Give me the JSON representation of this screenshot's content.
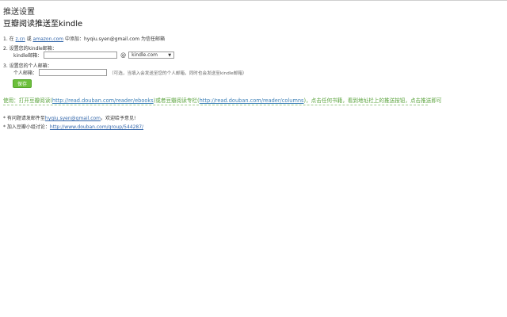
{
  "header": {
    "title": "推送设置",
    "subtitle": "豆瓣阅读推送至kindle"
  },
  "step1": {
    "prefix": "1. 在 ",
    "link1": "z.cn",
    "middle1": " 或 ",
    "link2": "amazon.com",
    "middle2": " 中添加：hyqiu.syen@gmail.com 为信任邮箱"
  },
  "step2": {
    "title": "2. 设置您的kindle邮箱：",
    "label": "kindle邮箱：",
    "input_value": "",
    "at": "@",
    "domain_selected": "kindle.com"
  },
  "step3": {
    "title": "3. 设置您的个人邮箱：",
    "label": "个人邮箱：",
    "input_value": "",
    "hint": "（可选，当填入会发送至您的个人邮箱，同时也会发送至kindle邮箱）"
  },
  "save_label": "保存",
  "usage": {
    "prefix": "使用：打开豆瓣阅读(",
    "link1": "http://read.douban.com/reader/ebooks",
    "middle": ")或者豆瓣阅读专栏(",
    "link2": "http://read.douban.com/reader/columns",
    "suffix": ")，点击任何书籍，看到地址栏上的推送按钮，点击推送即可"
  },
  "footer": {
    "line1_prefix": "* 有问题请发邮件至",
    "line1_link": "hyqiu.syen@gmail.com",
    "line1_suffix": "，欢迎给予意见!",
    "line2_prefix": "* 加入豆瓣小组讨论：",
    "line2_link": "http://www.douban.com/group/544287/"
  },
  "colors": {
    "accent_green": "#6bbf3a",
    "link_blue": "#3366aa",
    "note_green": "#5aa33c"
  }
}
